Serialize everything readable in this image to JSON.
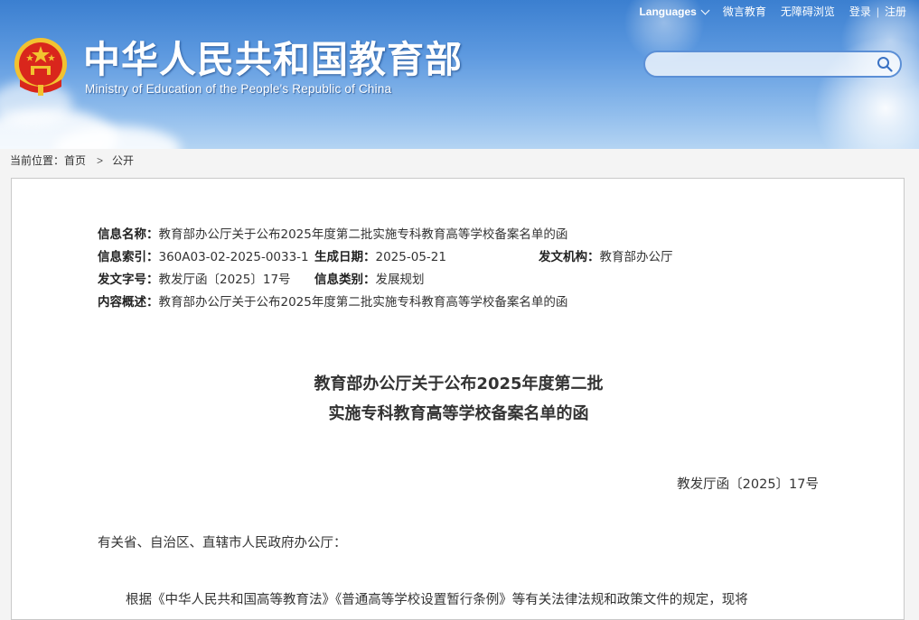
{
  "header": {
    "site_title": "中华人民共和国教育部",
    "site_subtitle": "Ministry of Education of the People's Republic of China",
    "toplinks": {
      "languages": "Languages",
      "weibo": "微言教育",
      "accessibility": "无障碍浏览",
      "login": "登录",
      "register": "注册",
      "separator": "|"
    },
    "search": {
      "placeholder": ""
    }
  },
  "breadcrumb": {
    "prefix": "当前位置：",
    "home": "首页",
    "arrow": ">",
    "current": "公开"
  },
  "meta": {
    "name_label": "信息名称：",
    "name_value": "教育部办公厅关于公布2025年度第二批实施专科教育高等学校备案名单的函",
    "index_label": "信息索引：",
    "index_value": "360A03-02-2025-0033-1",
    "date_label": "生成日期：",
    "date_value": "2025-05-21",
    "issuer_label": "发文机构：",
    "issuer_value": "教育部办公厅",
    "docno_label": "发文字号：",
    "docno_value": "教发厅函〔2025〕17号",
    "category_label": "信息类别：",
    "category_value": "发展规划",
    "summary_label": "内容概述：",
    "summary_value": "教育部办公厅关于公布2025年度第二批实施专科教育高等学校备案名单的函"
  },
  "document": {
    "title_line1": "教育部办公厅关于公布2025年度第二批",
    "title_line2": "实施专科教育高等学校备案名单的函",
    "docno": "教发厅函〔2025〕17号",
    "salutation": "有关省、自治区、直辖市人民政府办公厅：",
    "para1": "根据《中华人民共和国高等教育法》《普通高等学校设置暂行条例》等有关法律法规和政策文件的规定，现将"
  },
  "colors": {
    "header_top": "#3b7fd0",
    "header_bottom": "#b4d4f3",
    "search_border": "#5b8fd6",
    "emblem_red": "#d9261c",
    "emblem_gold": "#f2c230"
  },
  "icons": {
    "emblem": "national-emblem",
    "search": "search-icon",
    "language_chevron": "chevron-down-icon"
  }
}
